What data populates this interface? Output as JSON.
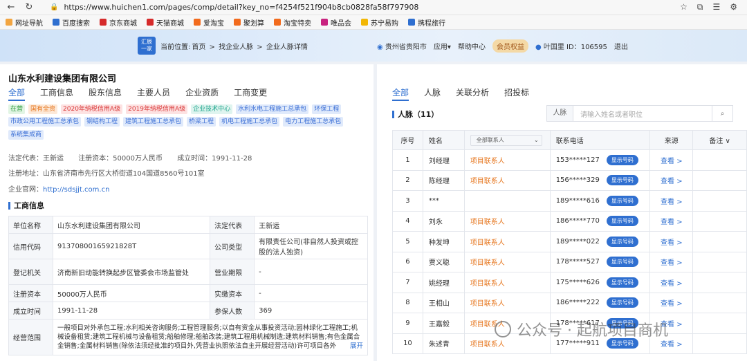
{
  "browser": {
    "url": "https://www.huichen1.com/pages/comp/detail?key_no=f4254f521f904b8cb0828fa58f797908",
    "bookmarks": [
      "网址导航",
      "百度搜索",
      "京东商城",
      "天猫商城",
      "爱淘宝",
      "聚划算",
      "淘宝特卖",
      "唯品会",
      "苏宁易购",
      "携程旅行"
    ]
  },
  "site": {
    "logo_top": "汇辰",
    "logo_bottom": "一家",
    "crumb": {
      "prefix": "当前位置:",
      "home": "首页",
      "sep1": " > ",
      "find": "找企业人脉",
      "sep2": " > ",
      "current": "企业人脉详情"
    },
    "location": "贵州省贵阳市",
    "apps": "应用▾",
    "help": "帮助中心",
    "vip": "会员权益",
    "user": "叶国里 ID：106595",
    "logout": "退出"
  },
  "company": {
    "name": "山东水利建设集团有限公司",
    "tabs": [
      "全部",
      "工商信息",
      "股东信息",
      "主要人员",
      "企业资质",
      "工商变更"
    ],
    "tags_row1": [
      "在营",
      "国有全资",
      "2020年纳税信用A级",
      "2019年纳税信用A级",
      "企业技术中心",
      "水利水电工程施工总承包",
      "环保工程"
    ],
    "tags_row2": [
      "市政公用工程施工总承包",
      "钢结构工程",
      "建筑工程施工总承包",
      "桥梁工程",
      "机电工程施工总承包",
      "电力工程施工总承包"
    ],
    "tags_row3": [
      "系统集成商"
    ],
    "legal_rep": "法定代表：王新运",
    "capital": "注册资本：50000万人民币",
    "founded": "成立时间：1991-11-28",
    "address": "注册地址：山东省济南市先行区大桥街道104国道8560号101室",
    "website_label": "企业官网：",
    "website": "http://sdsjjt.com.cn",
    "section_title": "工商信息",
    "biz": {
      "unit_name_k": "单位名称",
      "unit_name_v": "山东水利建设集团有限公司",
      "legal_k": "法定代表",
      "legal_v": "王新运",
      "credit_k": "信用代码",
      "credit_v": "91370800165921828T",
      "type_k": "公司类型",
      "type_v": "有限责任公司(非自然人投资或控股的法人独资)",
      "reg_k": "登记机关",
      "reg_v": "济南新旧动能转换起步区管委会市场监管处",
      "period_k": "营业期限",
      "period_v": "-",
      "cap_k": "注册资本",
      "cap_v": "50000万人民币",
      "paid_k": "实缴资本",
      "paid_v": "-",
      "date_k": "成立时间",
      "date_v": "1991-11-28",
      "ins_k": "参保人数",
      "ins_v": "369",
      "scope_k": "经营范围",
      "scope_v": "一般项目对外承包工程;水利相关咨询服务;工程管理服务;以自有资金从事投资活动;园林绿化工程施工;机械设备租赁;建筑工程机械与设备租赁;船舶修理;船舶改装;建筑工程用机械制造;建筑材料销售;有色金属合金销售;金属材料销售(除依法须经批准的项目外,凭营业执照依法自主开展经营活动)许可项目各外",
      "expand": "展开"
    }
  },
  "contacts": {
    "tabs": [
      "全部",
      "人脉",
      "关联分析",
      "招投标"
    ],
    "title": "人脉（11）",
    "search_label": "人脉",
    "search_placeholder": "请输入姓名或者职位",
    "headers": {
      "no": "序号",
      "name": "姓名",
      "filter": "全部联系人",
      "phone": "联系电话",
      "source": "来源",
      "note": "备注 ∨"
    },
    "show_btn": "显示号码",
    "view": "查看 >",
    "rows": [
      {
        "no": "1",
        "name": "刘经理",
        "role": "项目联系人",
        "phone": "153*****127"
      },
      {
        "no": "2",
        "name": "陈经理",
        "role": "项目联系人",
        "phone": "156*****329"
      },
      {
        "no": "3",
        "name": "***",
        "role": "",
        "phone": "189*****616"
      },
      {
        "no": "4",
        "name": "刘永",
        "role": "项目联系人",
        "phone": "186*****770"
      },
      {
        "no": "5",
        "name": "种发坤",
        "role": "项目联系人",
        "phone": "189*****022"
      },
      {
        "no": "6",
        "name": "贾义聪",
        "role": "项目联系人",
        "phone": "178*****527"
      },
      {
        "no": "7",
        "name": "姚经理",
        "role": "项目联系人",
        "phone": "175*****626"
      },
      {
        "no": "8",
        "name": "王相山",
        "role": "项目联系人",
        "phone": "186*****222"
      },
      {
        "no": "9",
        "name": "王嘉毅",
        "role": "项目联系人",
        "phone": "178*****617"
      },
      {
        "no": "10",
        "name": "朱述青",
        "role": "项目联系人",
        "phone": "177*****911"
      }
    ]
  },
  "watermark": "公众号 · 起航项目商机"
}
